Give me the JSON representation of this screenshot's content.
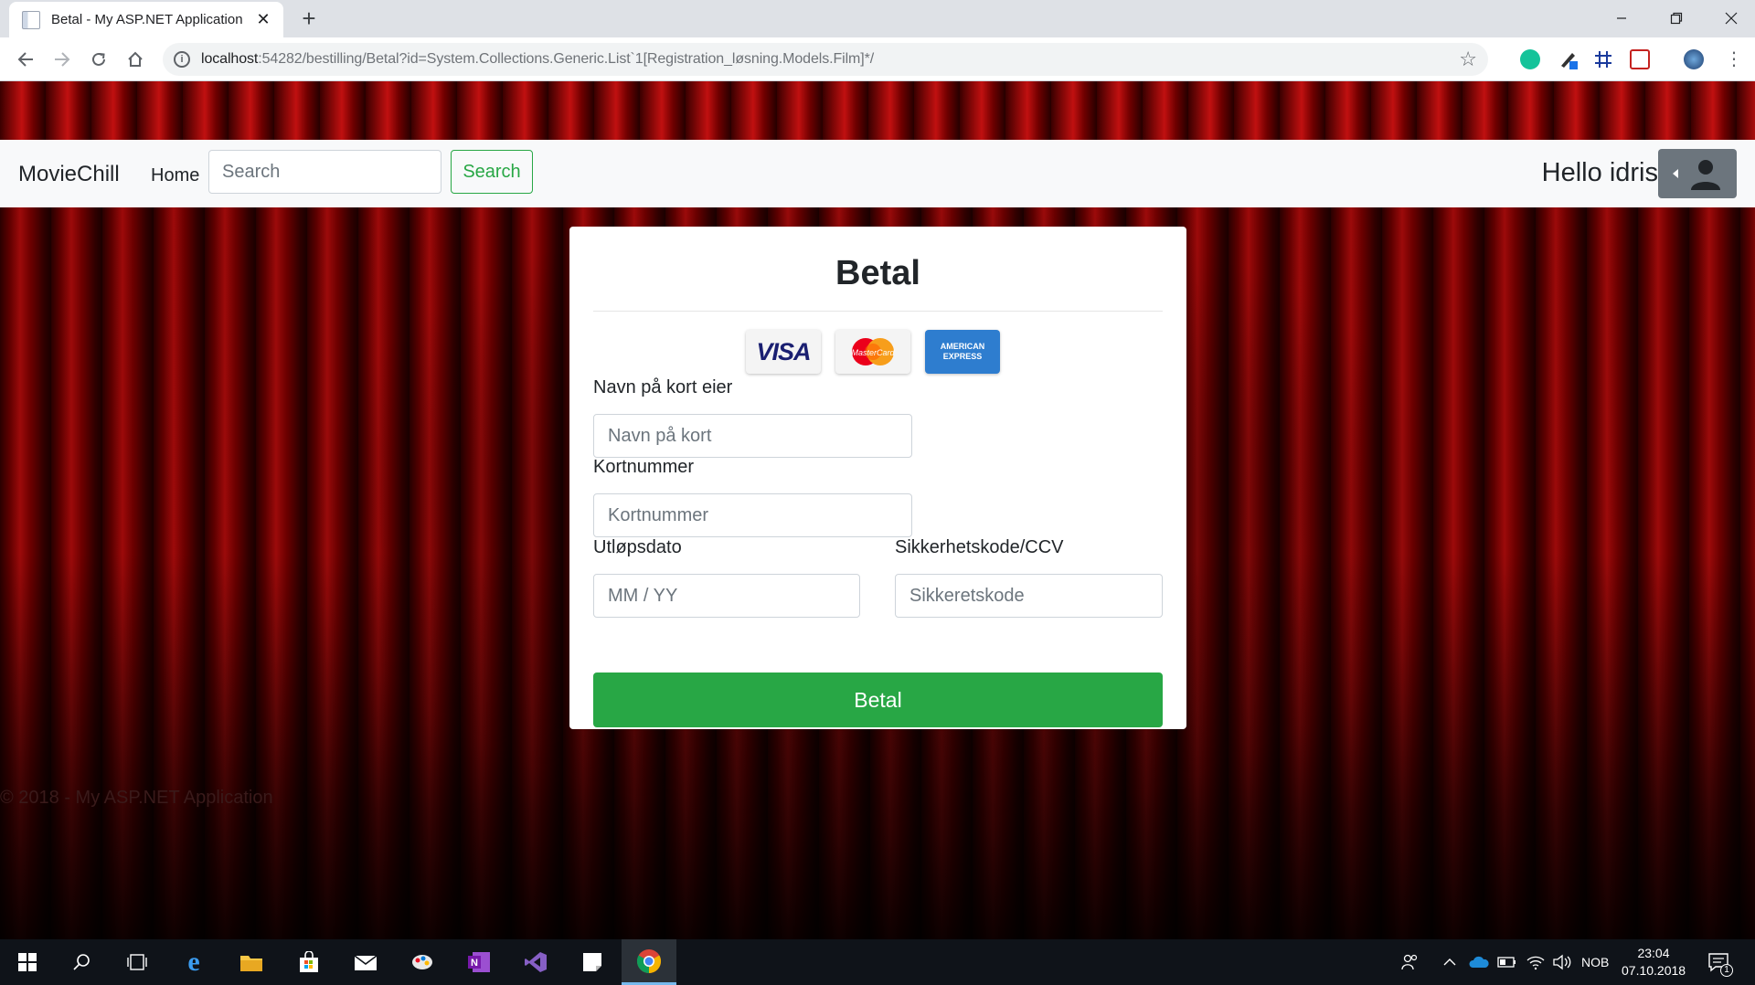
{
  "browser": {
    "tab_title": "Betal - My ASP.NET Application",
    "url_host": "localhost",
    "url_rest": ":54282/bestilling/Betal?id=System.Collections.Generic.List`1[Registration_løsning.Models.Film]*/"
  },
  "navbar": {
    "brand": "MovieChill",
    "home_label": "Home",
    "search_placeholder": "Search",
    "search_button": "Search",
    "greeting": "Hello idris"
  },
  "payment": {
    "title": "Betal",
    "card_brands": [
      "VISA",
      "MasterCard",
      "AMERICAN EXPRESS"
    ],
    "name_label": "Navn på kort eier",
    "name_placeholder": "Navn på kort",
    "number_label": "Kortnummer",
    "number_placeholder": "Kortnummer",
    "expiry_label": "Utløpsdato",
    "expiry_placeholder": "MM / YY",
    "cvv_label": "Sikkerhetskode/CCV",
    "cvv_placeholder": "Sikkeretskode",
    "submit": "Betal"
  },
  "footer": {
    "text": "© 2018 - My ASP.NET Application"
  },
  "taskbar": {
    "language": "NOB",
    "time": "23:04",
    "date": "07.10.2018",
    "notifications": "1"
  },
  "colors": {
    "accent_green": "#28a745",
    "curtain_red": "#9c0a0a",
    "navbar_bg": "#f8f9fa"
  }
}
